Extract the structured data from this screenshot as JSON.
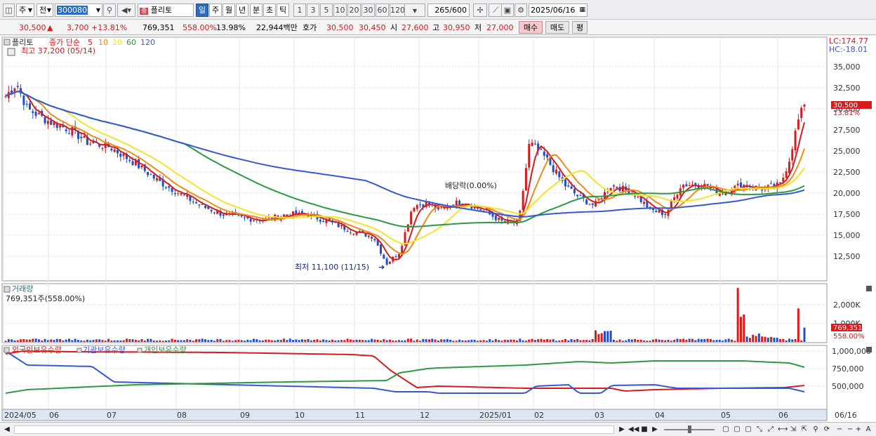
{
  "toolbar": {
    "market": "주",
    "prev_label": "전",
    "code": "300080",
    "name": "플리토",
    "periods": [
      "일",
      "주",
      "월",
      "년",
      "분",
      "초",
      "틱"
    ],
    "selected_period": "일",
    "numbers": [
      "1",
      "3",
      "5",
      "10",
      "20",
      "30",
      "60",
      "120"
    ],
    "count": "265",
    "count_total": "/600",
    "date": "2025/06/16"
  },
  "quote": {
    "price": "30,500",
    "change_arrow": "▲",
    "change": "3,700",
    "change_pct": "+13.81%",
    "volume": "769,351",
    "vol_ratio": "558.00%",
    "turnover_rate": "13.98%",
    "trade_value": "22,944백만",
    "ask_label": "호가",
    "ask": "30,500",
    "bid": "30,450",
    "open_label": "시",
    "open": "27,600",
    "high_label": "고",
    "high": "30,950",
    "low_label": "저",
    "low": "27,000",
    "buy": "매수",
    "sell": "매도",
    "eval": "평"
  },
  "price_pane": {
    "stock": "플리토",
    "ma_label": "종가 단순",
    "ma_periods": [
      "5",
      "10",
      "20",
      "60",
      "120"
    ],
    "ma_colors": [
      "#d81b1b",
      "#ef8c11",
      "#f2e52b",
      "#2a9b40",
      "#3558d8"
    ],
    "max_label": "최고 37,200 (05/14)",
    "min_label": "최저 11,100 (11/15)",
    "dividend_label": "배당락(0.00%)",
    "lc": "LC:174.77",
    "hc": "HC:-18.01",
    "last_price": "30,500",
    "last_pct": "13.81%",
    "y_ticks": [
      "35,000",
      "32,500",
      "30,000",
      "27,500",
      "25,000",
      "22,500",
      "20,000",
      "17,500",
      "15,000",
      "12,500"
    ]
  },
  "volume_pane": {
    "title": "거래량",
    "info": "769,351주(558.00%)",
    "y_ticks": [
      "2,000K",
      "1,000K"
    ],
    "last_volume": "769,351",
    "last_pct": "558.00%"
  },
  "holding_pane": {
    "legend": [
      "외국인보유수량",
      "기관보유수량",
      "개인보유수량"
    ],
    "legend_colors": [
      "#d81b1b",
      "#3558d8",
      "#2a9b40"
    ],
    "y_ticks": [
      "1,000,000",
      "750,000",
      "500,000"
    ]
  },
  "x_axis": [
    "2024/05",
    "06",
    "07",
    "08",
    "09",
    "10",
    "11",
    "12",
    "2025/01",
    "02",
    "03",
    "04",
    "05",
    "06",
    "06/16"
  ]
}
